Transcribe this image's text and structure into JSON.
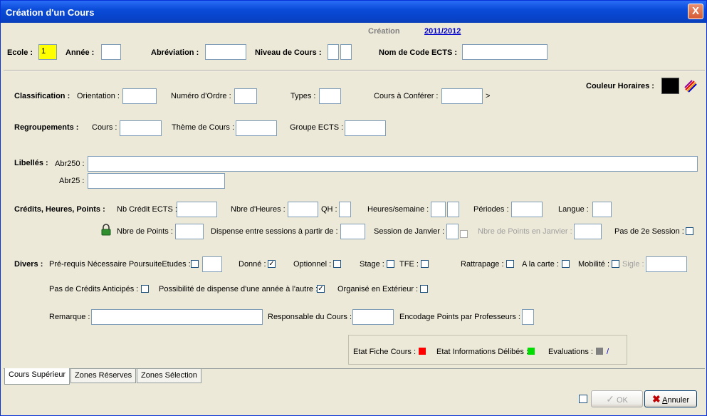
{
  "window": {
    "title": "Création d'un Cours",
    "close": "X"
  },
  "header": {
    "mode": "Création",
    "year": "2011/2012"
  },
  "row1": {
    "ecole": "Ecole :",
    "ecole_value": "1",
    "annee": "Année :",
    "abrev": "Abréviation :",
    "niveau": "Niveau de Cours :",
    "ects": "Nom de Code ECTS :"
  },
  "couleur": {
    "label": "Couleur Horaires :",
    "swatch": "#000000"
  },
  "classification": {
    "title": "Classification :",
    "orientation": "Orientation :",
    "numero": "Numéro d'Ordre :",
    "types": "Types :",
    "conferer": "Cours à Conférer :",
    "arrow": ">"
  },
  "regroupements": {
    "title": "Regroupements :",
    "cours": "Cours :",
    "theme": "Thème de Cours :",
    "groupe": "Groupe ECTS :"
  },
  "libelles": {
    "title": "Libellés :",
    "abr250": "Abr250 :",
    "abr25": "Abr25 :"
  },
  "credits": {
    "title": "Crédits, Heures, Points :",
    "nb_credit": "Nb Crédit ECTS :",
    "nbre_heures": "Nbre d'Heures :",
    "qh": "QH :",
    "heures_semaine": "Heures/semaine :",
    "periodes": "Périodes :",
    "langue": "Langue :",
    "nbre_points": "Nbre de Points :",
    "dispense": "Dispense entre sessions à partir de :",
    "session_janvier": "Session de Janvier :",
    "points_janvier": "Nbre de Points en Janvier :",
    "pas_2e": "Pas de 2e Session :"
  },
  "divers": {
    "title": "Divers :",
    "prerequis": "Pré-requis Nécessaire PoursuiteEtudes :",
    "donne": "Donné :",
    "optionnel": "Optionnel :",
    "stage": "Stage :",
    "tfe": "TFE :",
    "rattrapage": "Rattrapage :",
    "a_la_carte": "A la carte :",
    "mobilite": "Mobilité :",
    "sigle": "Sigle :",
    "pas_credits": "Pas de Crédits Anticipés :",
    "possibilite": "Possibilité de dispense d'une année à l'autre :",
    "organise": "Organisé en Extérieur :",
    "remarque": "Remarque :",
    "responsable": "Responsable du Cours :",
    "encodage": "Encodage Points par Professeurs :",
    "check": "✓"
  },
  "status": {
    "fiche": "Etat Fiche Cours :",
    "fiche_color": "#ff0000",
    "delibes": "Etat Informations Délibés :",
    "delibes_color": "#00dd00",
    "evaluations": "Evaluations :",
    "eval_color": "#808080",
    "slash": "/"
  },
  "tabs": [
    {
      "label": "Cours Supérieur"
    },
    {
      "label": "Zones Réserves"
    },
    {
      "label": "Zones Sélection"
    }
  ],
  "buttons": {
    "ok": "OK",
    "annuler_rest": "nnuler",
    "annuler_first": "A"
  }
}
